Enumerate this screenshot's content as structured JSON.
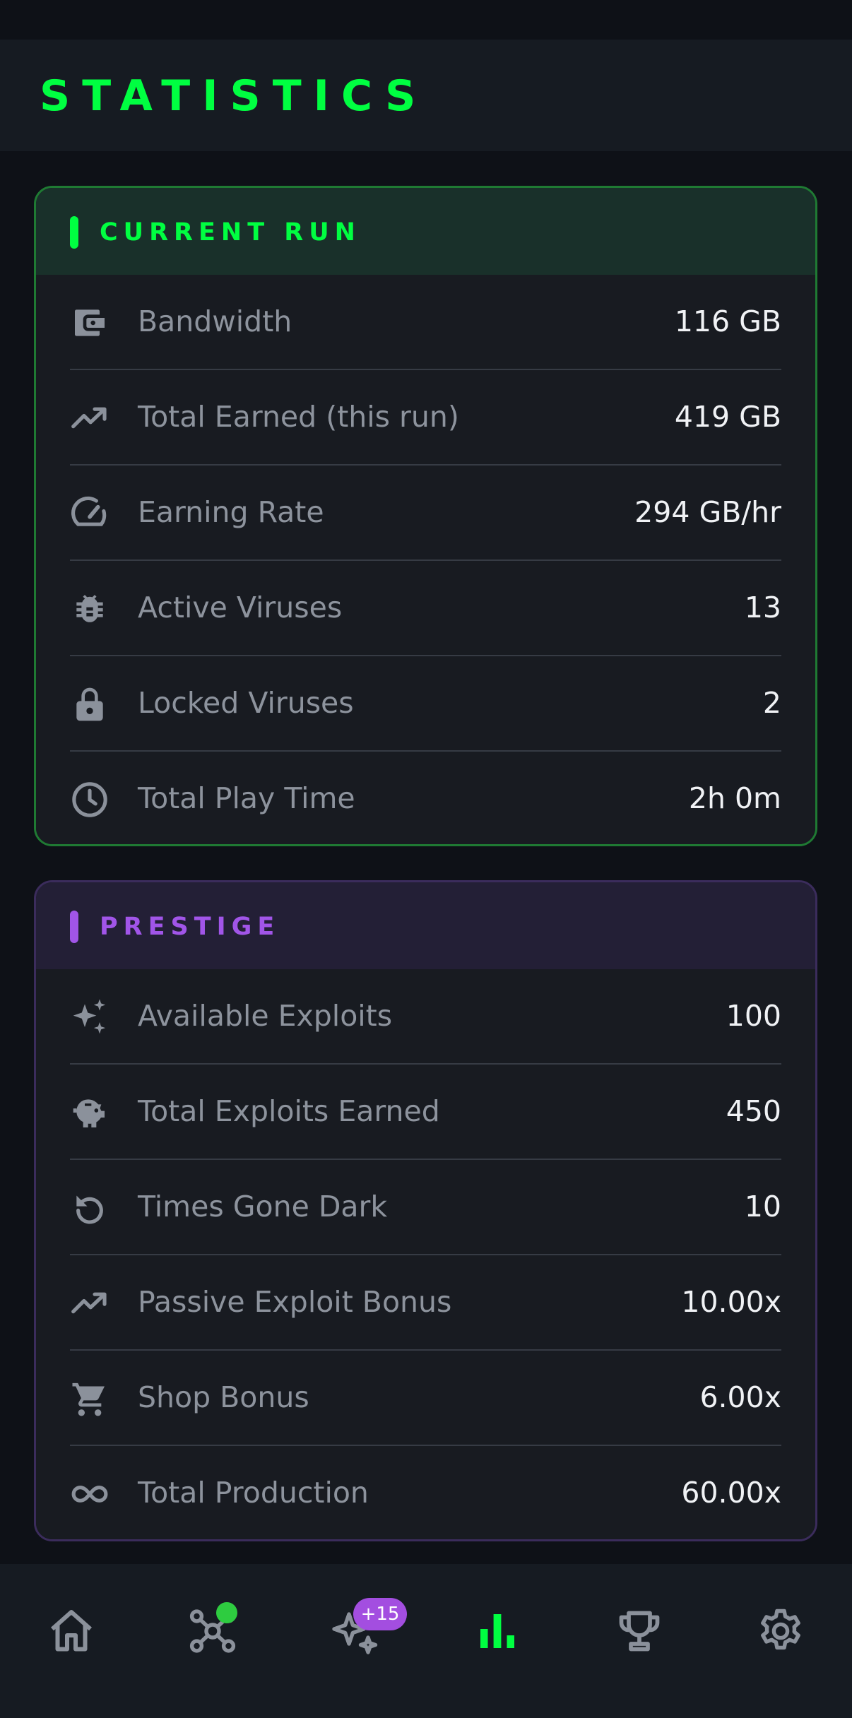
{
  "header": {
    "title": "STATISTICS"
  },
  "current_run": {
    "title": "CURRENT RUN",
    "accent": "#00ff41",
    "rows": [
      {
        "icon": "wallet-icon",
        "label": "Bandwidth",
        "value": "116 GB"
      },
      {
        "icon": "trending-up-icon",
        "label": "Total Earned (this run)",
        "value": "419 GB"
      },
      {
        "icon": "speedometer-icon",
        "label": "Earning Rate",
        "value": "294 GB/hr"
      },
      {
        "icon": "bug-icon",
        "label": "Active Viruses",
        "value": "13"
      },
      {
        "icon": "lock-icon",
        "label": "Locked Viruses",
        "value": "2"
      },
      {
        "icon": "clock-icon",
        "label": "Total Play Time",
        "value": "2h 0m"
      }
    ]
  },
  "prestige": {
    "title": "PRESTIGE",
    "accent": "#a155e8",
    "rows": [
      {
        "icon": "sparkles-icon",
        "label": "Available Exploits",
        "value": "100"
      },
      {
        "icon": "piggy-bank-icon",
        "label": "Total Exploits Earned",
        "value": "450"
      },
      {
        "icon": "reset-icon",
        "label": "Times Gone Dark",
        "value": "10"
      },
      {
        "icon": "trending-up-icon",
        "label": "Passive Exploit Bonus",
        "value": "10.00x"
      },
      {
        "icon": "cart-icon",
        "label": "Shop Bonus",
        "value": "6.00x"
      },
      {
        "icon": "infinity-icon",
        "label": "Total Production",
        "value": "60.00x"
      }
    ]
  },
  "nav": {
    "items": [
      {
        "icon": "home-icon",
        "active": false
      },
      {
        "icon": "network-icon",
        "active": false,
        "dot": true
      },
      {
        "icon": "sparkles-icon",
        "active": false,
        "badge": "+15"
      },
      {
        "icon": "bar-chart-icon",
        "active": true
      },
      {
        "icon": "trophy-icon",
        "active": false
      },
      {
        "icon": "gear-icon",
        "active": false
      }
    ]
  }
}
